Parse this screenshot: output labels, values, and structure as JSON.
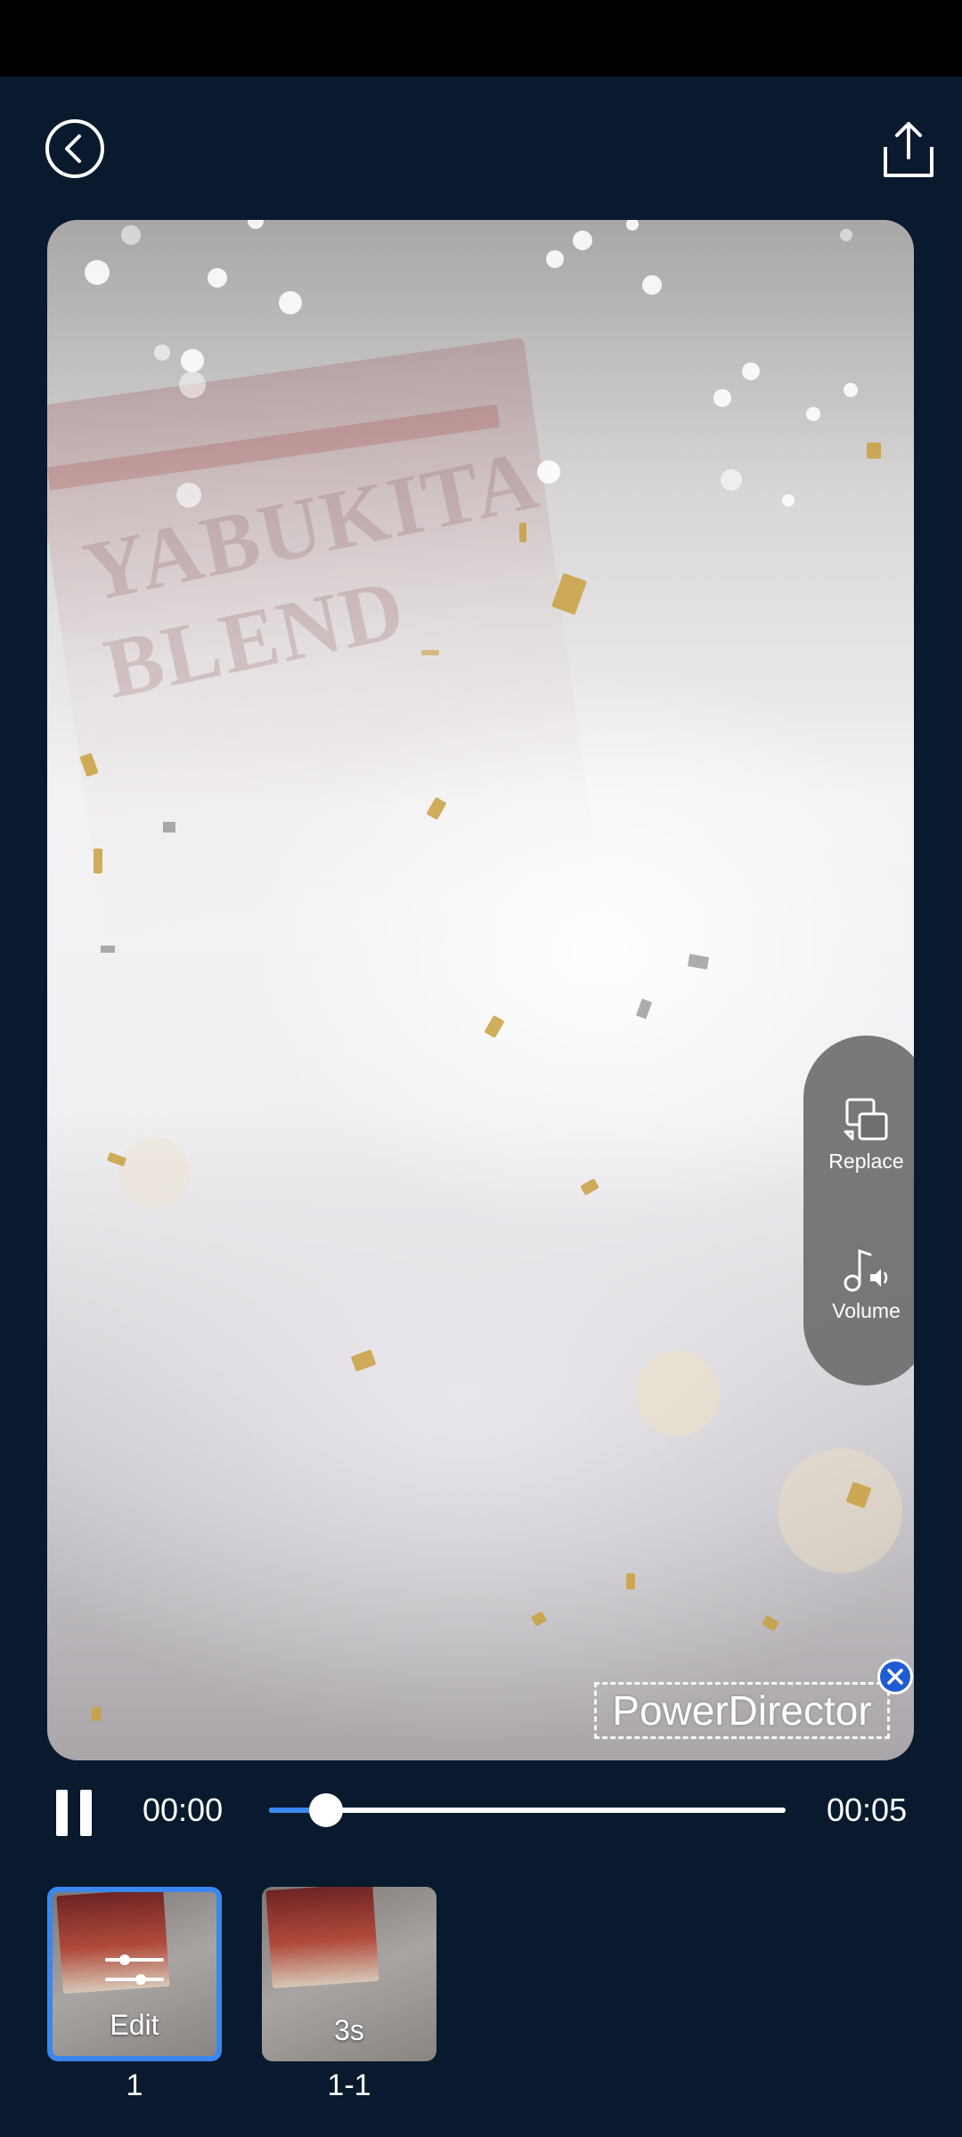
{
  "header": {
    "back_icon": "chevron-left-circle-icon",
    "share_icon": "share-upload-icon"
  },
  "preview": {
    "package_text": "YABUKITA BLEND",
    "side_actions": [
      {
        "label": "Replace",
        "icon": "replace-media-icon"
      },
      {
        "label": "Volume",
        "icon": "music-volume-icon"
      }
    ],
    "watermark": {
      "text": "PowerDirector",
      "close_icon": "close-icon",
      "color": "#1f5bd3"
    }
  },
  "player": {
    "current_time": "00:00",
    "total_time": "00:05",
    "progress": 0.11,
    "pause_icon": "pause-icon",
    "accent": "#3a87f0"
  },
  "clips": [
    {
      "overlay_label": "Edit",
      "number": "1",
      "selected": true,
      "overlay_icon": "sliders-icon"
    },
    {
      "overlay_label": "3s",
      "number": "1-1",
      "selected": false
    }
  ]
}
